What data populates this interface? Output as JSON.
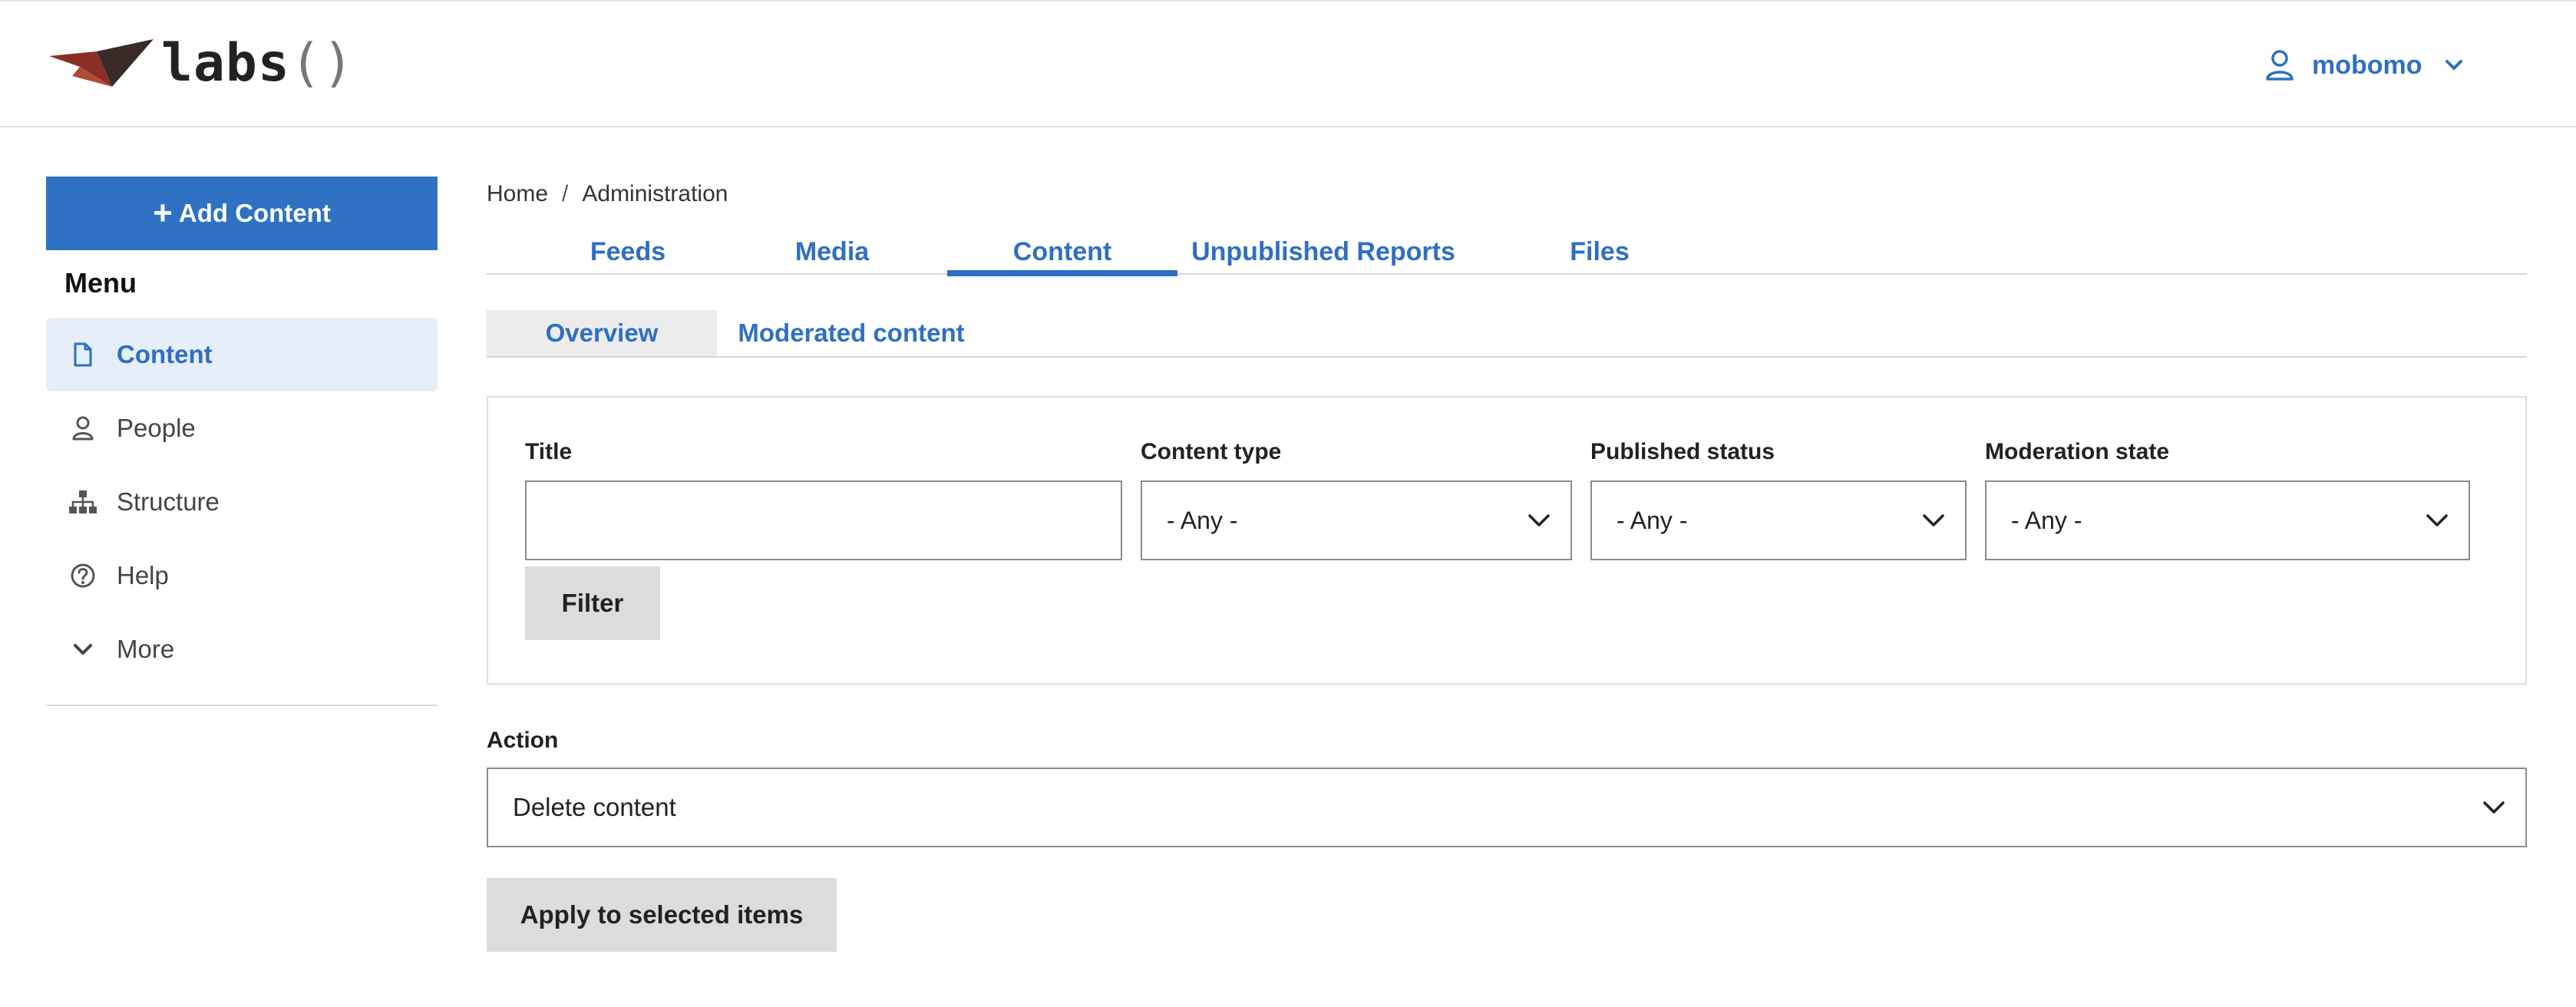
{
  "header": {
    "logo_text": "labs",
    "logo_paren": "()",
    "user_name": "mobomo"
  },
  "sidebar": {
    "add_button_label": "Add Content",
    "menu_title": "Menu",
    "items": [
      {
        "label": "Content",
        "icon": "document-icon",
        "active": true
      },
      {
        "label": "People",
        "icon": "person-icon",
        "active": false
      },
      {
        "label": "Structure",
        "icon": "sitemap-icon",
        "active": false
      },
      {
        "label": "Help",
        "icon": "help-icon",
        "active": false
      },
      {
        "label": "More",
        "icon": "chevron-down-icon",
        "active": false
      }
    ]
  },
  "breadcrumb": {
    "items": [
      "Home",
      "Administration"
    ],
    "separator": "/"
  },
  "tabs": [
    {
      "label": "Feeds",
      "active": false
    },
    {
      "label": "Media",
      "active": false
    },
    {
      "label": "Content",
      "active": true
    },
    {
      "label": "Unpublished Reports",
      "active": false
    },
    {
      "label": "Files",
      "active": false
    }
  ],
  "subtabs": [
    {
      "label": "Overview",
      "active": true
    },
    {
      "label": "Moderated content",
      "active": false
    }
  ],
  "filters": {
    "title": {
      "label": "Title",
      "value": ""
    },
    "content_type": {
      "label": "Content type",
      "value": "- Any -"
    },
    "published_status": {
      "label": "Published status",
      "value": "- Any -"
    },
    "moderation_state": {
      "label": "Moderation state",
      "value": "- Any -"
    },
    "filter_button": "Filter"
  },
  "action": {
    "label": "Action",
    "value": "Delete content",
    "apply_button": "Apply to selected items"
  },
  "colors": {
    "accent": "#2f72c4",
    "link": "#2f6fc4",
    "active_bg": "#e6eef9",
    "button_gray": "#dcdcdc"
  }
}
